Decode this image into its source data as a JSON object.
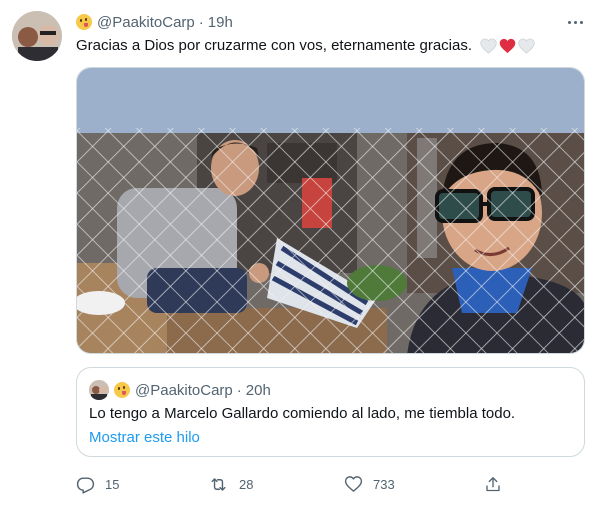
{
  "tweet": {
    "handle": "@PaakitoCarp",
    "separator": "·",
    "time": "19h",
    "text": "Gracias a Dios por cruzarme con vos, eternamente gracias.",
    "trailing_emojis": [
      "white-heart",
      "red-heart",
      "white-heart"
    ]
  },
  "quoted_tweet": {
    "handle": "@PaakitoCarp",
    "separator": "·",
    "time": "20h",
    "text": "Lo tengo a Marcelo Gallardo comiendo al lado, me tiembla todo.",
    "show_thread_label": "Mostrar este hilo"
  },
  "actions": {
    "reply_count": "15",
    "retweet_count": "28",
    "like_count": "733"
  },
  "colors": {
    "accent": "#1d9bf0",
    "secondary_text": "#536471",
    "border": "#cfd9de",
    "heart_red": "#e0245e"
  },
  "icons": [
    "more-icon",
    "reply-icon",
    "retweet-icon",
    "like-icon",
    "share-icon",
    "white-heart-icon",
    "red-heart-icon",
    "grinning-face-emoji-icon"
  ]
}
